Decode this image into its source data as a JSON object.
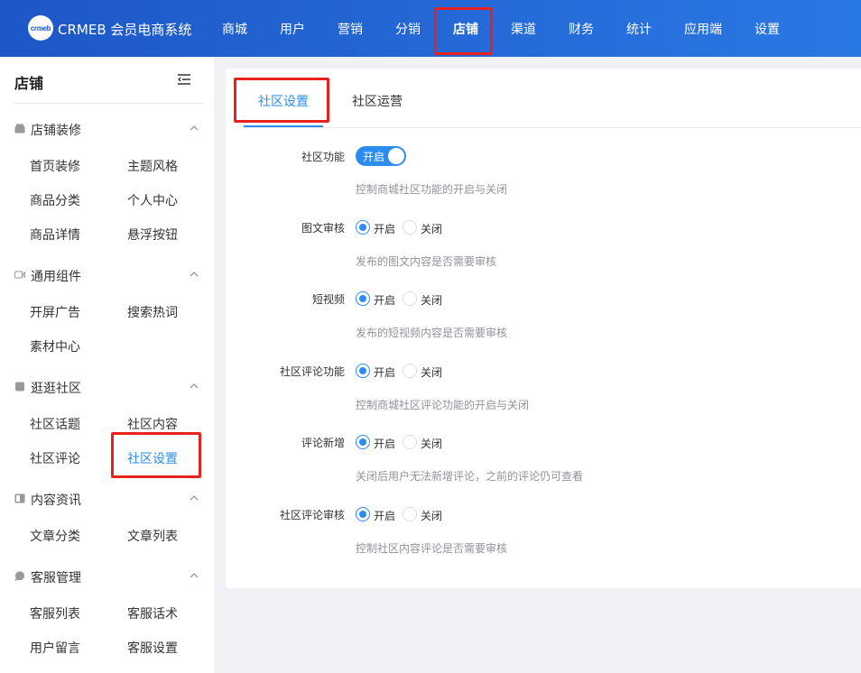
{
  "header": {
    "logo_text": "crmeb",
    "brand": "CRMEB 会员电商系统",
    "nav": [
      "商城",
      "用户",
      "营销",
      "分销",
      "店铺",
      "渠道",
      "财务",
      "统计",
      "应用端",
      "设置"
    ],
    "active_nav": "店铺",
    "colors": {
      "gradient_start": "#1e57c7",
      "gradient_end": "#2a78e4",
      "highlight": "#e8201f"
    }
  },
  "sidebar": {
    "title": "店铺",
    "groups": [
      {
        "label": "店铺装修",
        "icon": "store-decor-icon",
        "items": [
          "首页装修",
          "主题风格",
          "商品分类",
          "个人中心",
          "商品详情",
          "悬浮按钮"
        ]
      },
      {
        "label": "通用组件",
        "icon": "video-icon",
        "items": [
          "开屏广告",
          "搜索热词",
          "素材中心"
        ]
      },
      {
        "label": "逛逛社区",
        "icon": "community-icon",
        "items": [
          "社区话题",
          "社区内容",
          "社区评论",
          "社区设置"
        ]
      },
      {
        "label": "内容资讯",
        "icon": "article-icon",
        "items": [
          "文章分类",
          "文章列表"
        ]
      },
      {
        "label": "客服管理",
        "icon": "chat-icon",
        "items": [
          "客服列表",
          "客服话术",
          "用户留言",
          "客服设置"
        ]
      }
    ],
    "active_item": "社区设置",
    "accent": "#2d8cf0"
  },
  "tabs": [
    "社区设置",
    "社区运营"
  ],
  "active_tab": "社区设置",
  "form": {
    "switch_label": "社区功能",
    "switch_text": "开启",
    "switch_on": true,
    "switch_help": "控制商城社区功能的开启与关闭",
    "radio_on": "开启",
    "radio_off": "关闭",
    "rows": [
      {
        "label": "图文审核",
        "selected": "开启",
        "help": "发布的图文内容是否需要审核"
      },
      {
        "label": "短视频",
        "selected": "开启",
        "help": "发布的短视频内容是否需要审核"
      },
      {
        "label": "社区评论功能",
        "selected": "开启",
        "help": "控制商城社区评论功能的开启与关闭"
      },
      {
        "label": "评论新增",
        "selected": "开启",
        "help": "关闭后用户无法新增评论，之前的评论仍可查看"
      },
      {
        "label": "社区评论审核",
        "selected": "开启",
        "help": "控制社区内容评论是否需要审核"
      }
    ]
  }
}
